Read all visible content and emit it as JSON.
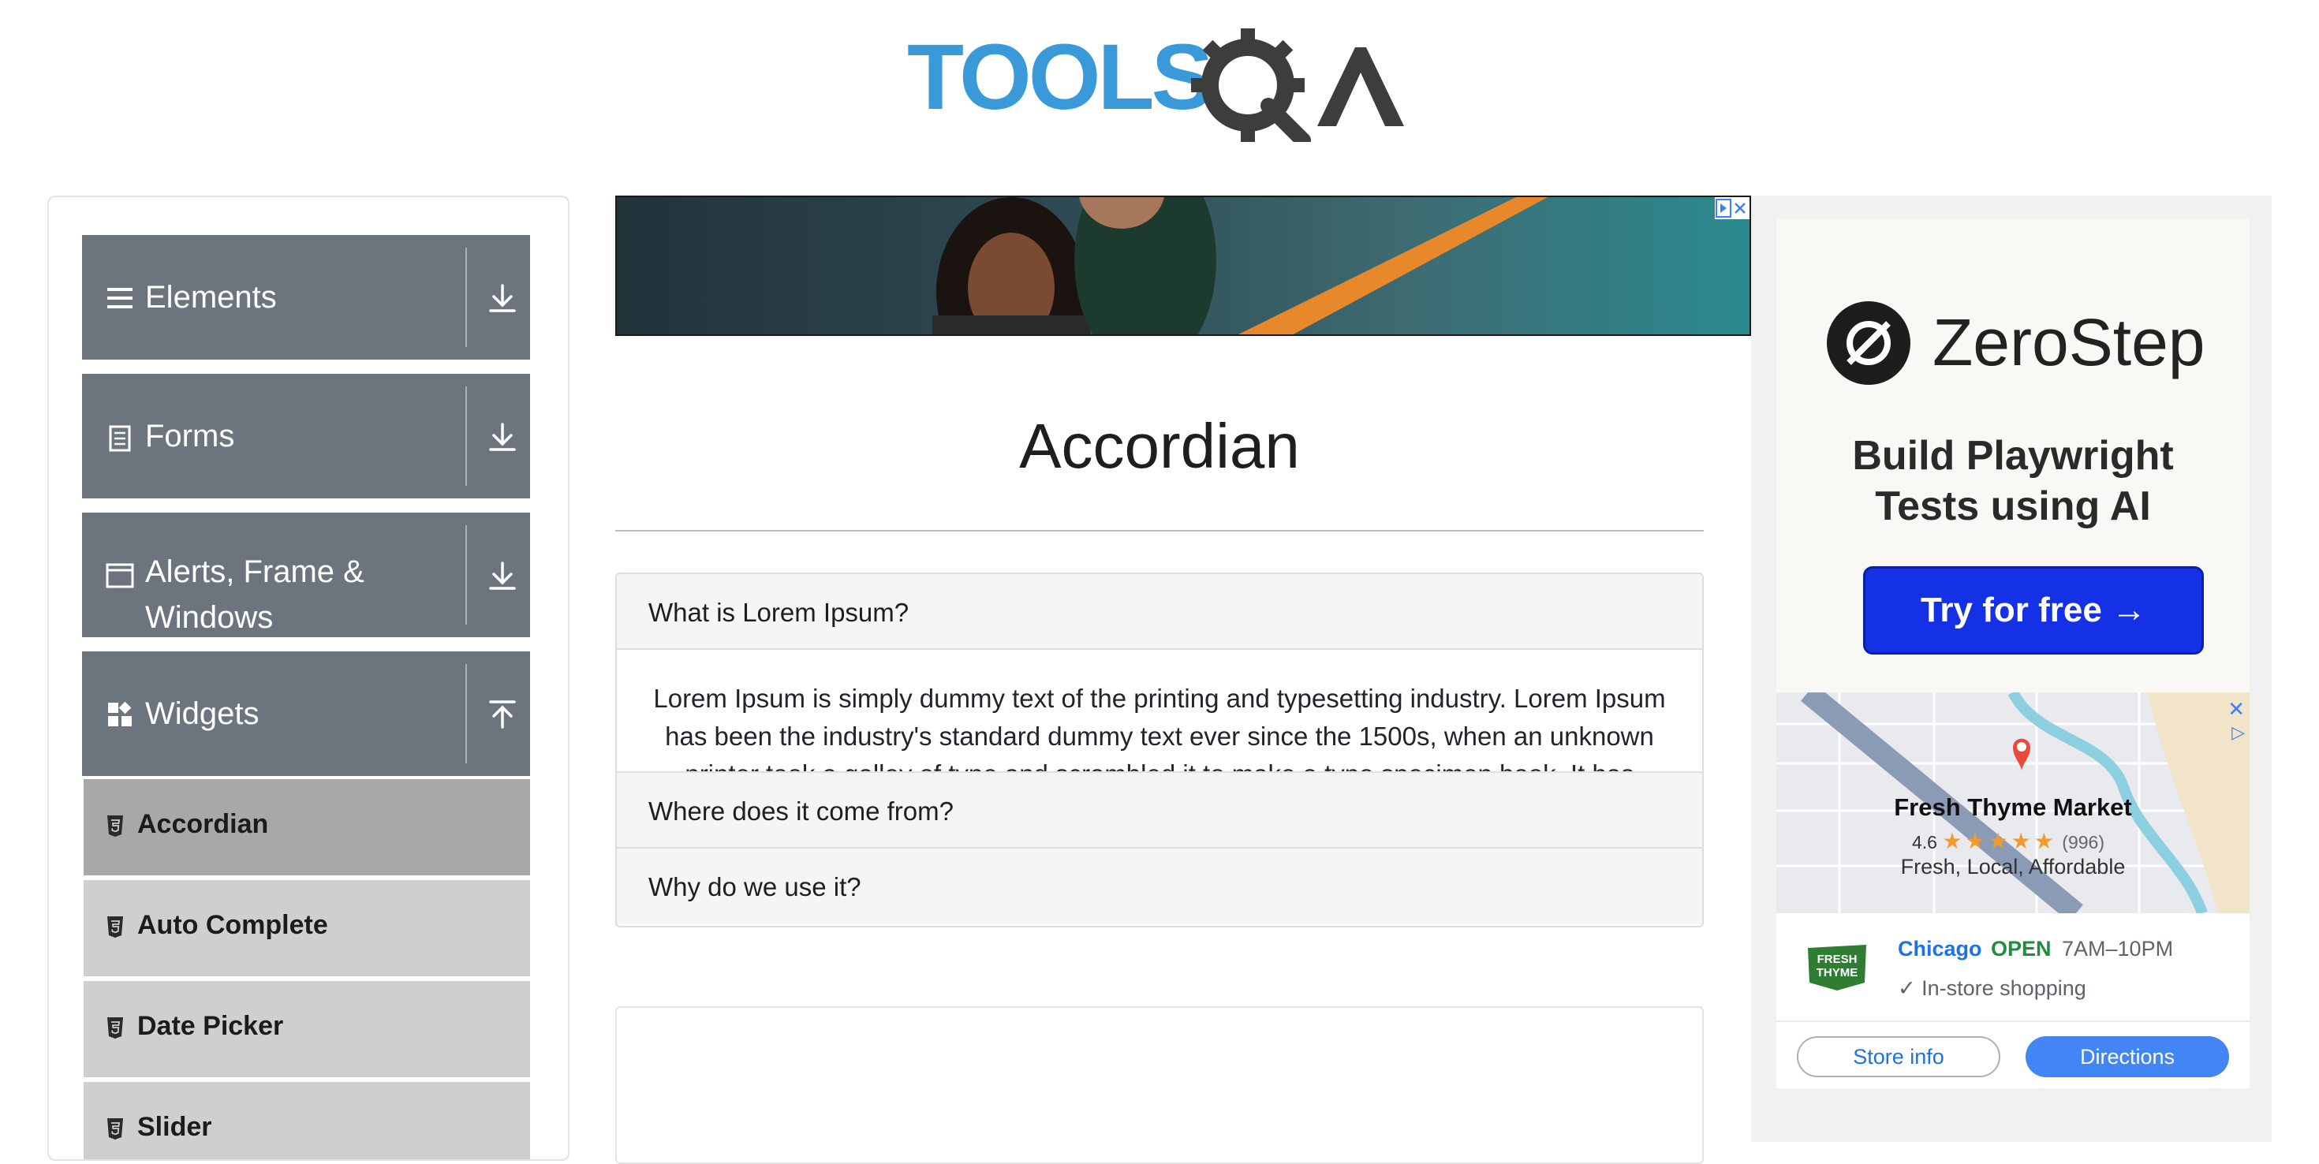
{
  "brand": {
    "logo_text": "TOOLSQA"
  },
  "sidebar": {
    "groups": [
      {
        "label": "Elements",
        "icon": "hamburger-icon",
        "state": "collapsed"
      },
      {
        "label": "Forms",
        "icon": "document-icon",
        "state": "collapsed"
      },
      {
        "label_line1": "Alerts, Frame &",
        "label_line2": "Windows",
        "icon": "window-icon",
        "state": "collapsed"
      },
      {
        "label": "Widgets",
        "icon": "widgets-icon",
        "state": "expanded"
      }
    ],
    "items": [
      {
        "label": "Accordian",
        "active": true
      },
      {
        "label": "Auto Complete",
        "active": false
      },
      {
        "label": "Date Picker",
        "active": false
      },
      {
        "label": "Slider",
        "active": false
      }
    ]
  },
  "main": {
    "title": "Accordian",
    "sections": [
      {
        "heading": "What is Lorem Ipsum?",
        "body": "Lorem Ipsum is simply dummy text of the printing and typesetting industry. Lorem Ipsum has been the industry's standard dummy text ever since the 1500s, when an unknown printer took a galley of type and scrambled it to make a type specimen book. It has"
      },
      {
        "heading": "Where does it come from?"
      },
      {
        "heading": "Why do we use it?"
      }
    ]
  },
  "ad": {
    "brand": "ZeroStep",
    "tagline_line1": "Build Playwright",
    "tagline_line2": "Tests using AI",
    "cta": "Try for free →",
    "store": {
      "name": "Fresh Thyme Market",
      "rating": "4.6",
      "stars": "★★★★★",
      "review_count": "(996)",
      "tagline": "Fresh, Local, Affordable",
      "city": "Chicago",
      "status": "OPEN",
      "hours": "7AM–10PM",
      "feature": "✓ In-store shopping",
      "store_info_label": "Store info",
      "directions_label": "Directions"
    }
  },
  "colors": {
    "sidebar_group": "#6c757d",
    "sidebar_item": "#cfcfcf",
    "sidebar_item_active": "#a8a8a8",
    "cta_blue": "#1531e6",
    "directions_blue": "#4285f4",
    "open_green": "#1e8e3e"
  }
}
